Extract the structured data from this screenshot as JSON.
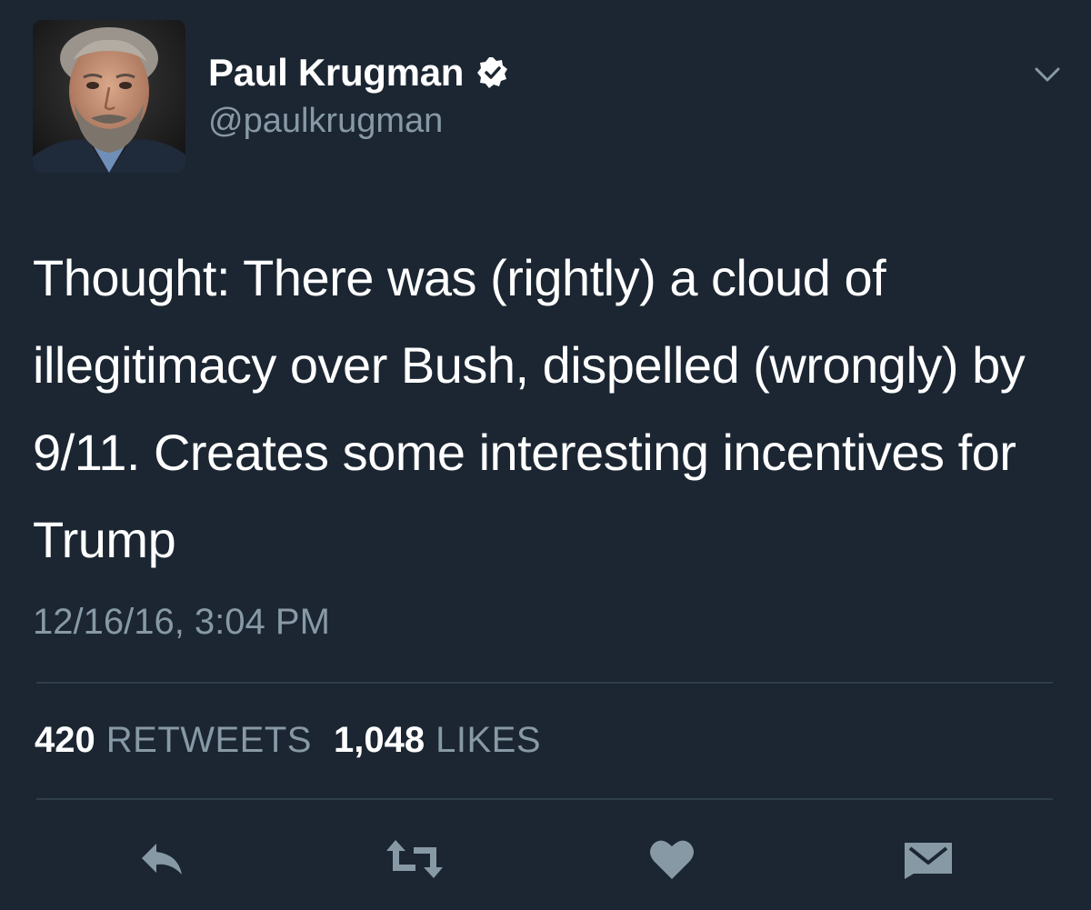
{
  "tweet": {
    "author": {
      "name": "Paul Krugman",
      "handle": "@paulkrugman",
      "verified": true
    },
    "text": "Thought: There was (rightly) a cloud of illegitimacy over Bush, dispelled (wrongly) by 9/11. Creates some interesting incentives for Trump",
    "timestamp": "12/16/16, 3:04 PM",
    "stats": {
      "retweets_count": "420",
      "retweets_label": "RETWEETS",
      "likes_count": "1,048",
      "likes_label": "LIKES"
    },
    "actions": [
      {
        "name": "reply",
        "icon": "reply-icon"
      },
      {
        "name": "retweet",
        "icon": "retweet-icon"
      },
      {
        "name": "like",
        "icon": "heart-icon"
      },
      {
        "name": "direct-message",
        "icon": "envelope-icon"
      }
    ]
  },
  "colors": {
    "background": "#1b2632",
    "primary_text": "#ffffff",
    "secondary_text": "#8899a6",
    "divider": "#2f3d4b",
    "icon": "#8899a6"
  }
}
